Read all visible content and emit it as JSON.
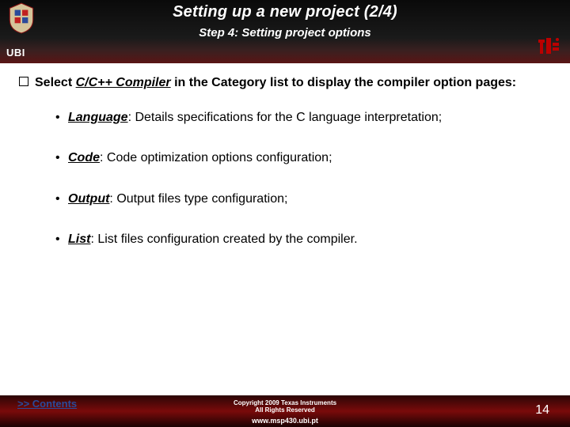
{
  "header": {
    "title": "Setting up a new project (2/4)",
    "subtitle": "Step 4: Setting project options",
    "ubi": "UBI"
  },
  "main": {
    "lead_before": "Select ",
    "lead_emph": "C/C++ Compiler",
    "lead_after": " in the Category list to display the compiler option pages:",
    "items": [
      {
        "term": "Language",
        "desc": ": Details specifications for the C language interpretation;"
      },
      {
        "term": "Code",
        "desc": ": Code optimization options configuration;"
      },
      {
        "term": "Output",
        "desc": ": Output files type configuration;"
      },
      {
        "term": "List",
        "desc": ": List files configuration created by the compiler."
      }
    ]
  },
  "footer": {
    "contents": ">> Contents",
    "copyright_line1": "Copyright 2009 Texas Instruments",
    "copyright_line2": "All Rights Reserved",
    "url": "www.msp430.ubi.pt",
    "page": "14"
  }
}
